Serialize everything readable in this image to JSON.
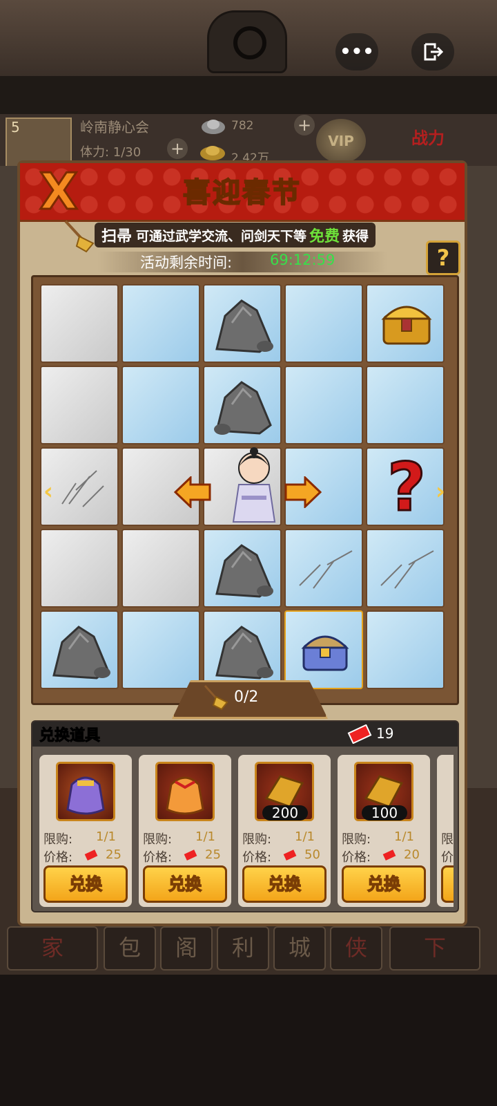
{
  "system": {
    "more_label": "•••",
    "exit_icon": "exit-icon"
  },
  "background": {
    "level": "5",
    "guild_name": "岭南静心会",
    "stamina": "体力: 1/30",
    "silver": "782",
    "gold": "2.42万",
    "vip_label": "VIP",
    "power_label": "战力",
    "nav_chars": [
      "家",
      "包",
      "阁",
      "利",
      "城",
      "侠",
      "下"
    ]
  },
  "dialog": {
    "title": "喜迎春节",
    "close_label": "X",
    "tip": {
      "item": "扫帚",
      "text_before": "可通过武学交流、问剑天下等",
      "free": "免费",
      "text_after": "获得"
    },
    "timer_label": "活动剩余时间:",
    "timer_value": "69:12:59",
    "help_label": "?"
  },
  "board": {
    "counter": "0/2",
    "mystery_label": "?",
    "side_left": "‹",
    "side_right": "›"
  },
  "exchange": {
    "title": "兑换道具",
    "ticket_count": "19",
    "limit_label": "限购:",
    "price_label": "价格:",
    "button_label": "兑换",
    "items": [
      {
        "icon": "purple-pouch-icon",
        "limit": "1/1",
        "price": "25",
        "qty": ""
      },
      {
        "icon": "orange-pouch-icon",
        "limit": "1/1",
        "price": "25",
        "qty": ""
      },
      {
        "icon": "gold-bar-icon",
        "limit": "1/1",
        "price": "50",
        "qty": "200"
      },
      {
        "icon": "gold-bar-icon",
        "limit": "1/1",
        "price": "20",
        "qty": "100"
      }
    ],
    "partial": {
      "limit_label": "限",
      "price_label": "价"
    }
  },
  "colors": {
    "header_red": "#b61c10",
    "timer_green": "#37e04a",
    "button_gold": "#f3a51a"
  }
}
